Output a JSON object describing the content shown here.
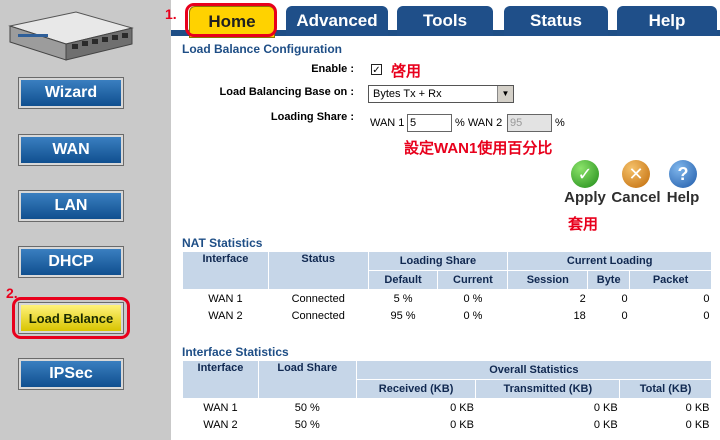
{
  "tabs": [
    {
      "label": "Home",
      "active": true
    },
    {
      "label": "Advanced",
      "active": false
    },
    {
      "label": "Tools",
      "active": false
    },
    {
      "label": "Status",
      "active": false
    },
    {
      "label": "Help",
      "active": false
    }
  ],
  "markers": {
    "one": "1.",
    "two": "2."
  },
  "sidebar": {
    "items": [
      "Wizard",
      "WAN",
      "LAN",
      "DHCP",
      "Load Balance",
      "IPSec"
    ]
  },
  "lb": {
    "title": "Load Balance Configuration",
    "enable_label": "Enable :",
    "enable_checked": "✓",
    "enable_note": "啓用",
    "base_label": "Load Balancing Base on :",
    "base_value": "Bytes Tx + Rx",
    "share_label": "Loading Share :",
    "wan1_prefix": "WAN 1",
    "wan1_value": "5",
    "mid": "% WAN 2",
    "wan2_value": "95",
    "pct": "%",
    "share_note": "設定WAN1使用百分比"
  },
  "actions": {
    "apply": "Apply",
    "cancel": "Cancel",
    "help": "Help",
    "apply_note": "套用"
  },
  "nat": {
    "title": "NAT Statistics",
    "headers": {
      "interface": "Interface",
      "status": "Status",
      "loading_share": "Loading Share",
      "current_loading": "Current Loading",
      "default": "Default",
      "current": "Current",
      "session": "Session",
      "byte": "Byte",
      "packet": "Packet"
    },
    "rows": [
      [
        "WAN 1",
        "Connected",
        "5 %",
        "0 %",
        "2",
        "0",
        "0"
      ],
      [
        "WAN 2",
        "Connected",
        "95 %",
        "0 %",
        "18",
        "0",
        "0"
      ]
    ]
  },
  "iface": {
    "title": "Interface Statistics",
    "headers": {
      "interface": "Interface",
      "load_share": "Load Share",
      "overall": "Overall Statistics",
      "received": "Received (KB)",
      "transmitted": "Transmitted (KB)",
      "total": "Total (KB)"
    },
    "rows": [
      [
        "WAN 1",
        "50 %",
        "0 KB",
        "0 KB",
        "0 KB"
      ],
      [
        "WAN 2",
        "50 %",
        "0 KB",
        "0 KB",
        "0 KB"
      ]
    ]
  },
  "colors": {
    "accent": "#1e4e86",
    "highlight": "#ffd200",
    "annotation": "#e8001c"
  }
}
